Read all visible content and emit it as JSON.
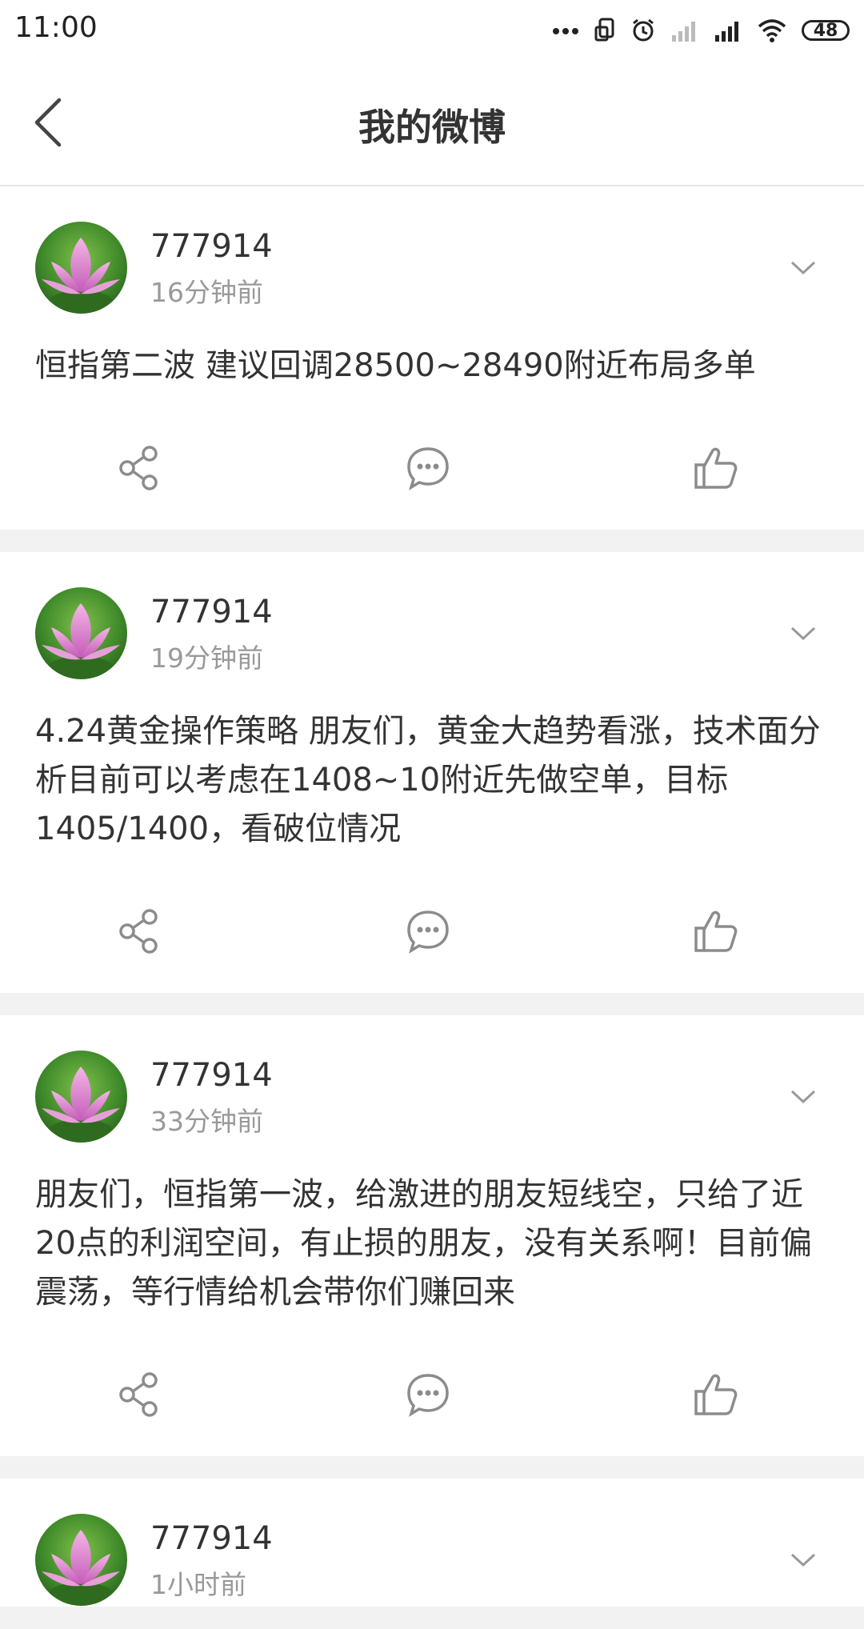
{
  "status_bar": {
    "time": "11:00",
    "battery": "48",
    "icons": [
      "dots-icon",
      "screen-rotate-icon",
      "alarm-icon",
      "signal-weak-icon",
      "signal-icon",
      "wifi-icon",
      "battery-icon"
    ]
  },
  "header": {
    "title": "我的微博",
    "back_icon": "back-arrow-icon"
  },
  "colors": {
    "text": "#333333",
    "muted": "#999999",
    "icon": "#8c8c8c",
    "background": "#f2f2f2"
  },
  "posts": [
    {
      "username": "777914",
      "time": "16分钟前",
      "text": "恒指第二波 建议回调28500~28490附近布局多单"
    },
    {
      "username": "777914",
      "time": "19分钟前",
      "text": "4.24黄金操作策略 朋友们，黄金大趋势看涨，技术面分析目前可以考虑在1408~10附近先做空单，目标1405/1400，看破位情况"
    },
    {
      "username": "777914",
      "time": "33分钟前",
      "text": "朋友们，恒指第一波，给激进的朋友短线空，只给了近20点的利润空间，有止损的朋友，没有关系啊！目前偏震荡，等行情给机会带你们赚回来"
    },
    {
      "username": "777914",
      "time": "1小时前",
      "text": ""
    }
  ]
}
